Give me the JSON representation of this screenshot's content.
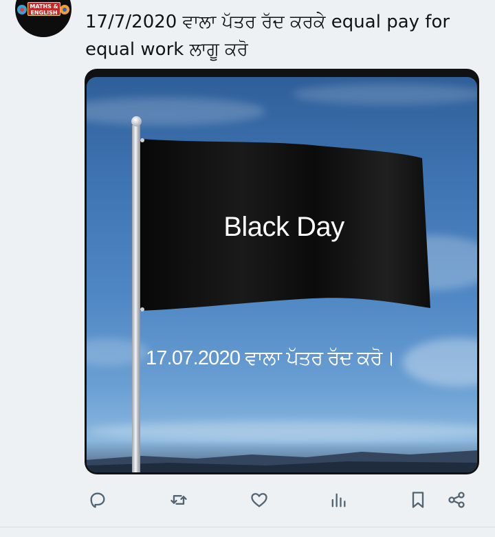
{
  "tweet": {
    "author_avatar_text": "MATHS & ENGLISH",
    "text": "17/7/2020 ਵਾਲਾ ਪੱਤਰ ਰੱਦ ਕਰਕੇ equal pay for equal work ਲਾਗੂ ਕਰੋ",
    "media": {
      "flag_text": "Black Day",
      "caption": "17.07.2020 ਵਾਲਾ ਪੱਤਰ ਰੱਦ ਕਰੋ।"
    }
  },
  "actions": [
    {
      "name": "reply",
      "icon": "reply-icon"
    },
    {
      "name": "retweet",
      "icon": "retweet-icon"
    },
    {
      "name": "like",
      "icon": "heart-icon"
    },
    {
      "name": "views",
      "icon": "analytics-icon"
    },
    {
      "name": "bookmark",
      "icon": "bookmark-icon"
    },
    {
      "name": "share",
      "icon": "share-icon"
    }
  ],
  "colors": {
    "icon": "#536471",
    "text": "#0f1419",
    "background": "#eef1f4"
  }
}
